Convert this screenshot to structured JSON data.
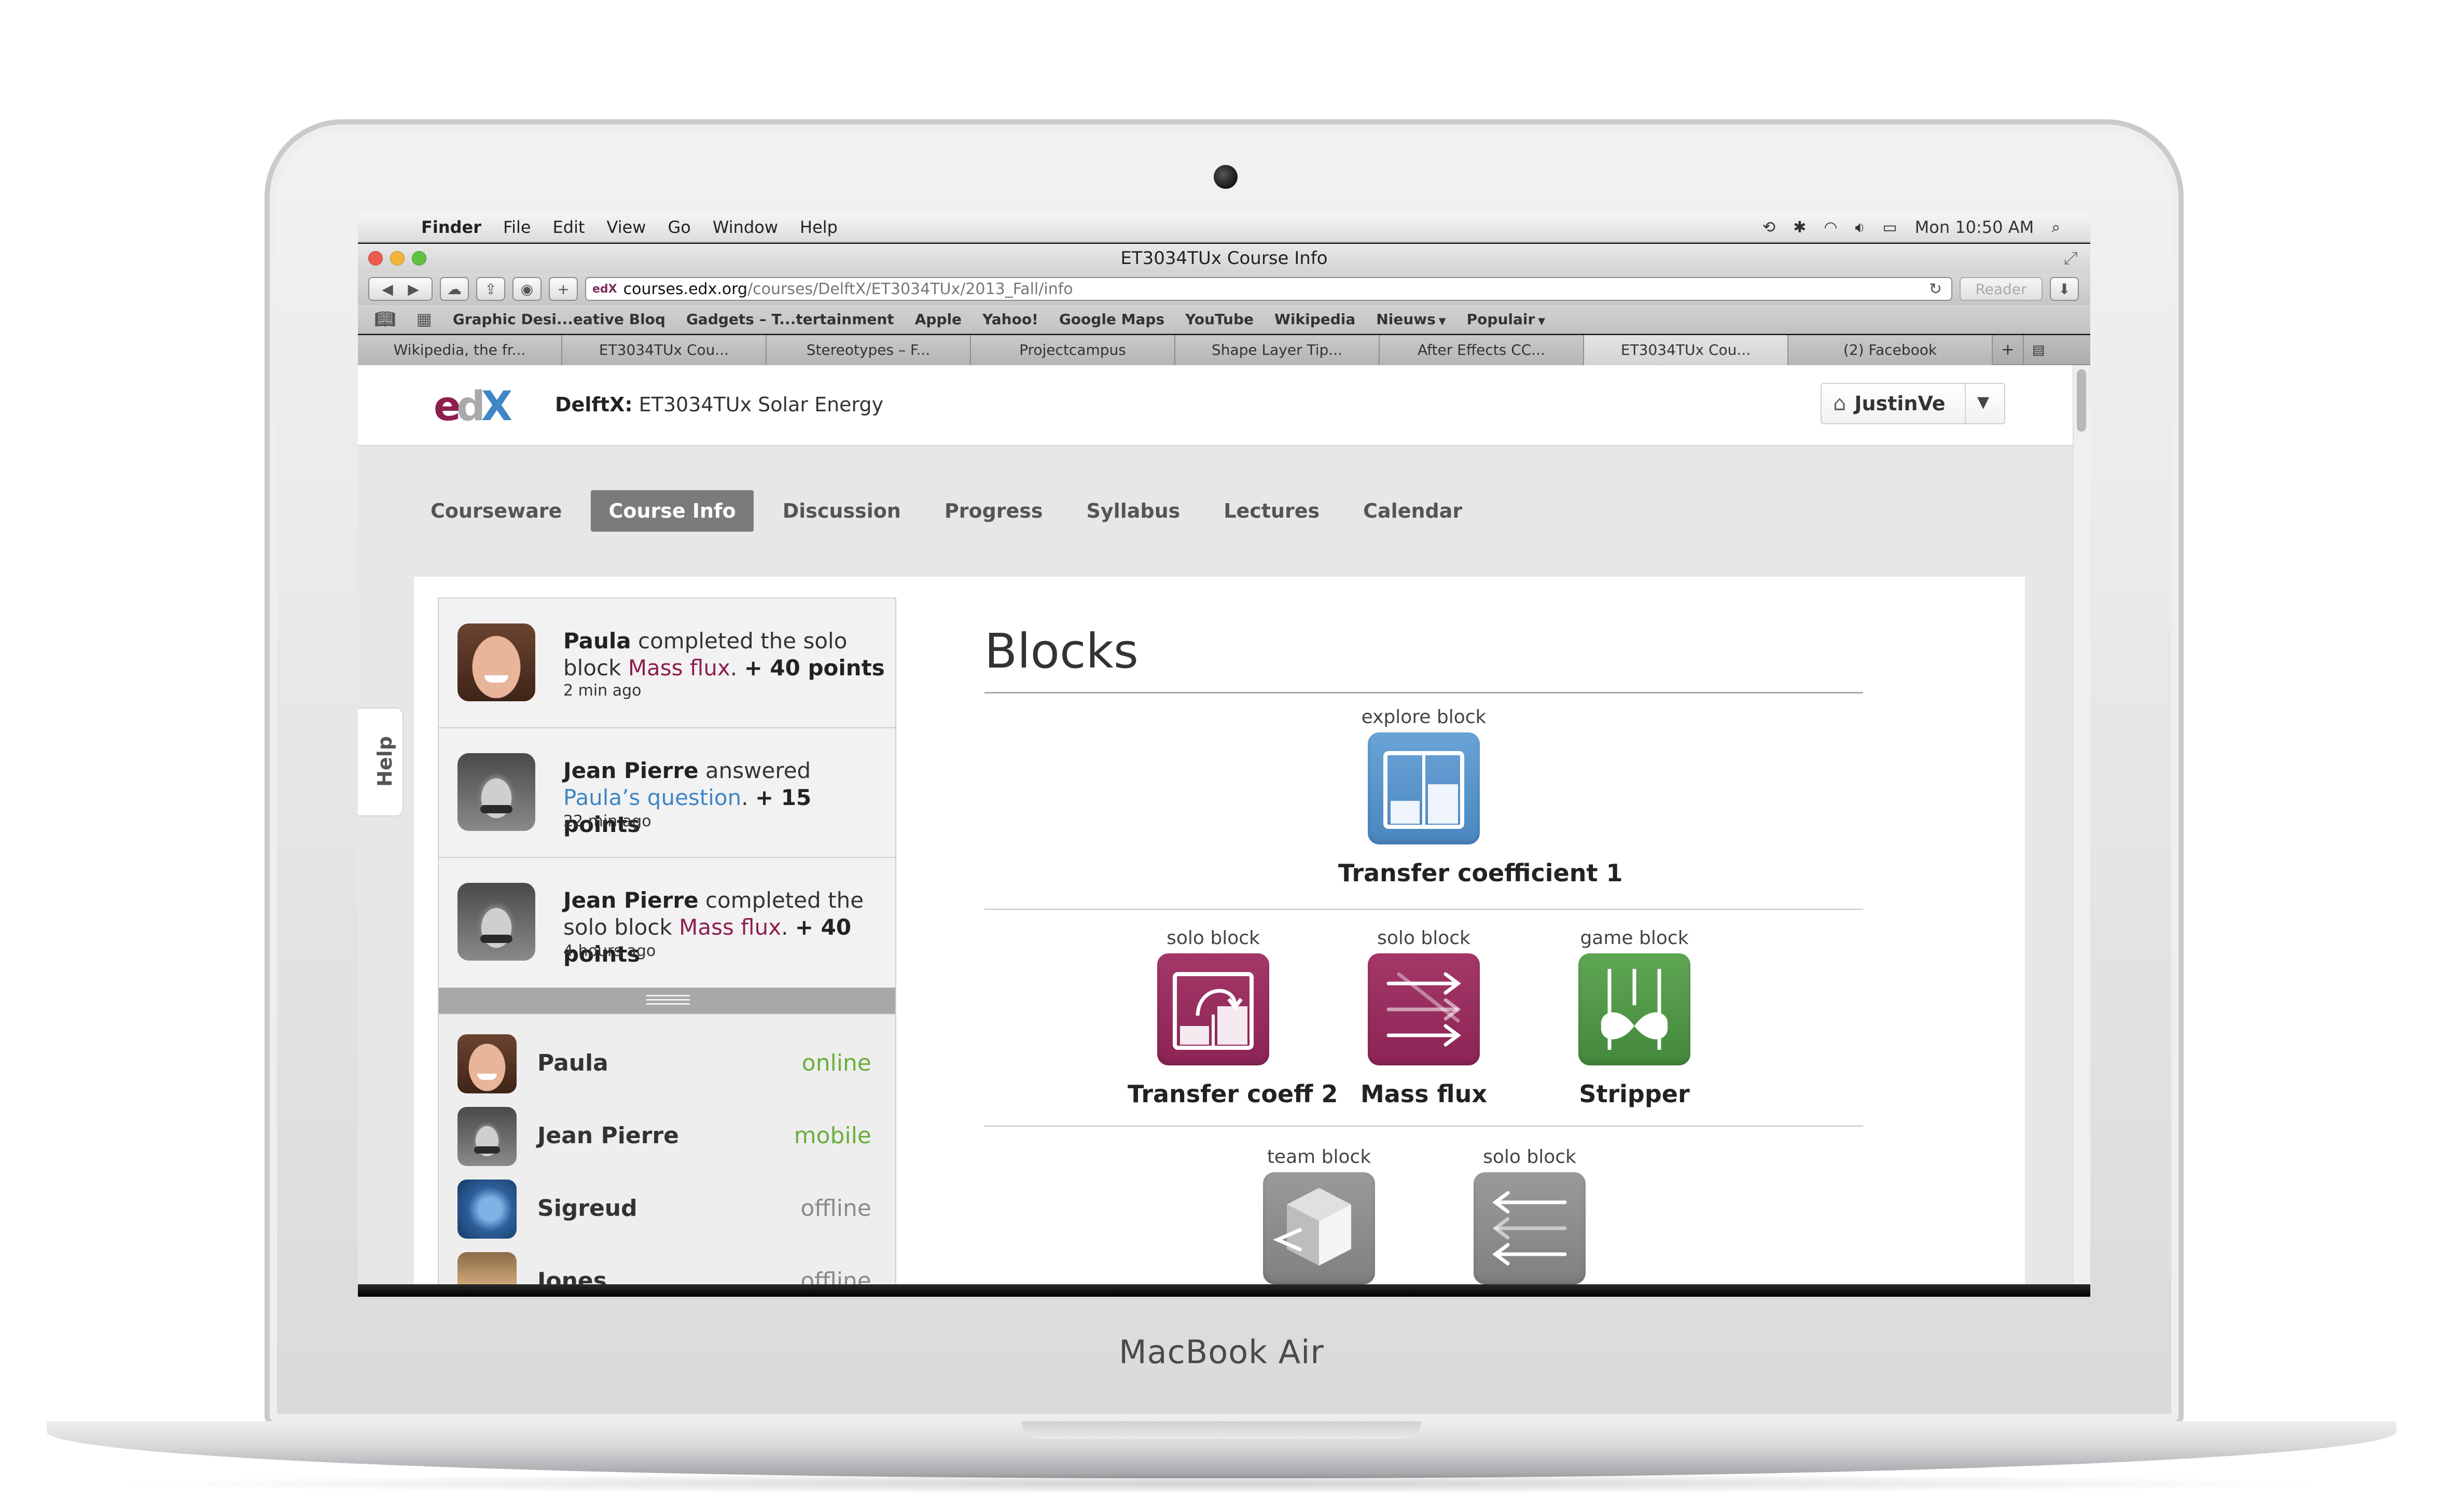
{
  "device": {
    "label": "MacBook Air"
  },
  "menubar": {
    "app": "Finder",
    "items": [
      "File",
      "Edit",
      "View",
      "Go",
      "Window",
      "Help"
    ],
    "clock": "Mon 10:50 AM"
  },
  "window": {
    "title": "ET3034TUx Course Info"
  },
  "toolbar": {
    "url_host": "courses.edx.org",
    "url_path": "/courses/DelftX/ET3034TUx/2013_Fall/info",
    "reader_label": "Reader",
    "site_icon": "edX"
  },
  "bookmarks": [
    {
      "label": "Graphic Desi...eative Bloq"
    },
    {
      "label": "Gadgets – T...tertainment"
    },
    {
      "label": "Apple"
    },
    {
      "label": "Yahoo!"
    },
    {
      "label": "Google Maps"
    },
    {
      "label": "YouTube"
    },
    {
      "label": "Wikipedia"
    },
    {
      "label": "Nieuws",
      "has_menu": true
    },
    {
      "label": "Populair",
      "has_menu": true
    }
  ],
  "tabs": [
    {
      "label": "Wikipedia, the fr...",
      "active": false
    },
    {
      "label": "ET3034TUx Cou...",
      "active": false
    },
    {
      "label": "Stereotypes – F...",
      "active": false
    },
    {
      "label": "Projectcampus",
      "active": false
    },
    {
      "label": "Shape Layer Tip...",
      "active": false
    },
    {
      "label": "After Effects CC...",
      "active": false
    },
    {
      "label": "ET3034TUx Cou...",
      "active": true
    },
    {
      "label": "(2) Facebook",
      "active": false
    }
  ],
  "site": {
    "org": "DelftX:",
    "course": "ET3034TUx Solar Energy",
    "username": "JustinVe",
    "help_label": "Help"
  },
  "coursenav": [
    {
      "label": "Courseware",
      "active": false
    },
    {
      "label": "Course Info",
      "active": true
    },
    {
      "label": "Discussion",
      "active": false
    },
    {
      "label": "Progress",
      "active": false
    },
    {
      "label": "Syllabus",
      "active": false
    },
    {
      "label": "Lectures",
      "active": false
    },
    {
      "label": "Calendar",
      "active": false
    }
  ],
  "feed": [
    {
      "user": "Paula",
      "verb": "completed the solo block",
      "object": "Mass flux",
      "suffix": ".",
      "points": "+ 40 points",
      "time": "2 min ago"
    },
    {
      "user": "Jean Pierre",
      "verb": "answered",
      "object": "Paula’s question",
      "suffix": ".",
      "points": "+ 15 points",
      "time": "22 min ago"
    },
    {
      "user": "Jean Pierre",
      "verb": "completed the solo block",
      "object": "Mass flux",
      "suffix": ".",
      "points": "+ 40 points",
      "time": "4 hours ago"
    }
  ],
  "people": [
    {
      "name": "Paula",
      "status": "online"
    },
    {
      "name": "Jean Pierre",
      "status": "mobile"
    },
    {
      "name": "Sigreud",
      "status": "offline"
    },
    {
      "name": "Jones",
      "status": "offline"
    }
  ],
  "blocks": {
    "title": "Blocks",
    "row1": [
      {
        "type": "explore block",
        "name": "Transfer coefficient 1",
        "color": "#5b95cc",
        "icon": "bar-chart-icon"
      }
    ],
    "row2": [
      {
        "type": "solo block",
        "name": "Transfer coeff 2",
        "color": "#9a2d5f",
        "icon": "transfer-chart-icon"
      },
      {
        "type": "solo block",
        "name": "Mass flux",
        "color": "#9a2d5f",
        "icon": "arrows-right-icon"
      },
      {
        "type": "game block",
        "name": "Stripper",
        "color": "#52994a",
        "icon": "stripper-icon"
      }
    ],
    "row3": [
      {
        "type": "team block",
        "name": "",
        "color": "#8d8d8d",
        "icon": "cube-icon"
      },
      {
        "type": "solo block",
        "name": "",
        "color": "#8d8d8d",
        "icon": "arrows-left-icon"
      }
    ]
  },
  "colors": {
    "edx_maroon": "#8e1f4f",
    "link_blue": "#3e86c4",
    "online_green": "#6aaf3a",
    "active_tab": "#7b7b7b"
  }
}
